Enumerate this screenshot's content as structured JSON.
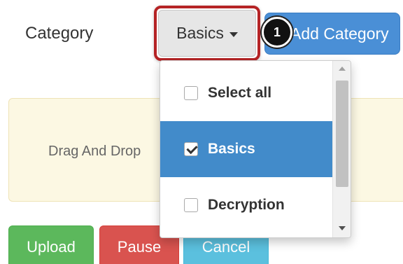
{
  "header": {
    "category_label": "Category",
    "dropdown_value": "Basics",
    "add_category_label": "Add Category",
    "step_number": "1"
  },
  "drop_zone": {
    "text": "Drag And Drop"
  },
  "actions": {
    "upload_label": "Upload",
    "pause_label": "Pause",
    "cancel_label": "Cancel"
  },
  "dropdown_menu": {
    "items": [
      {
        "label": "Select all",
        "checked": false,
        "selected": false
      },
      {
        "label": "Basics",
        "checked": true,
        "selected": true
      },
      {
        "label": "Decryption",
        "checked": false,
        "selected": false
      }
    ]
  },
  "colors": {
    "highlight": "#b52325",
    "primary": "#4a8fd6",
    "selected_item": "#428bca",
    "upload": "#5cb85c",
    "pause": "#d9534f",
    "cancel": "#5bc0de",
    "warning_bg": "#fcf8e3"
  },
  "icons": {
    "caret": "caret-down-icon",
    "checkbox": "checkbox-icon"
  }
}
